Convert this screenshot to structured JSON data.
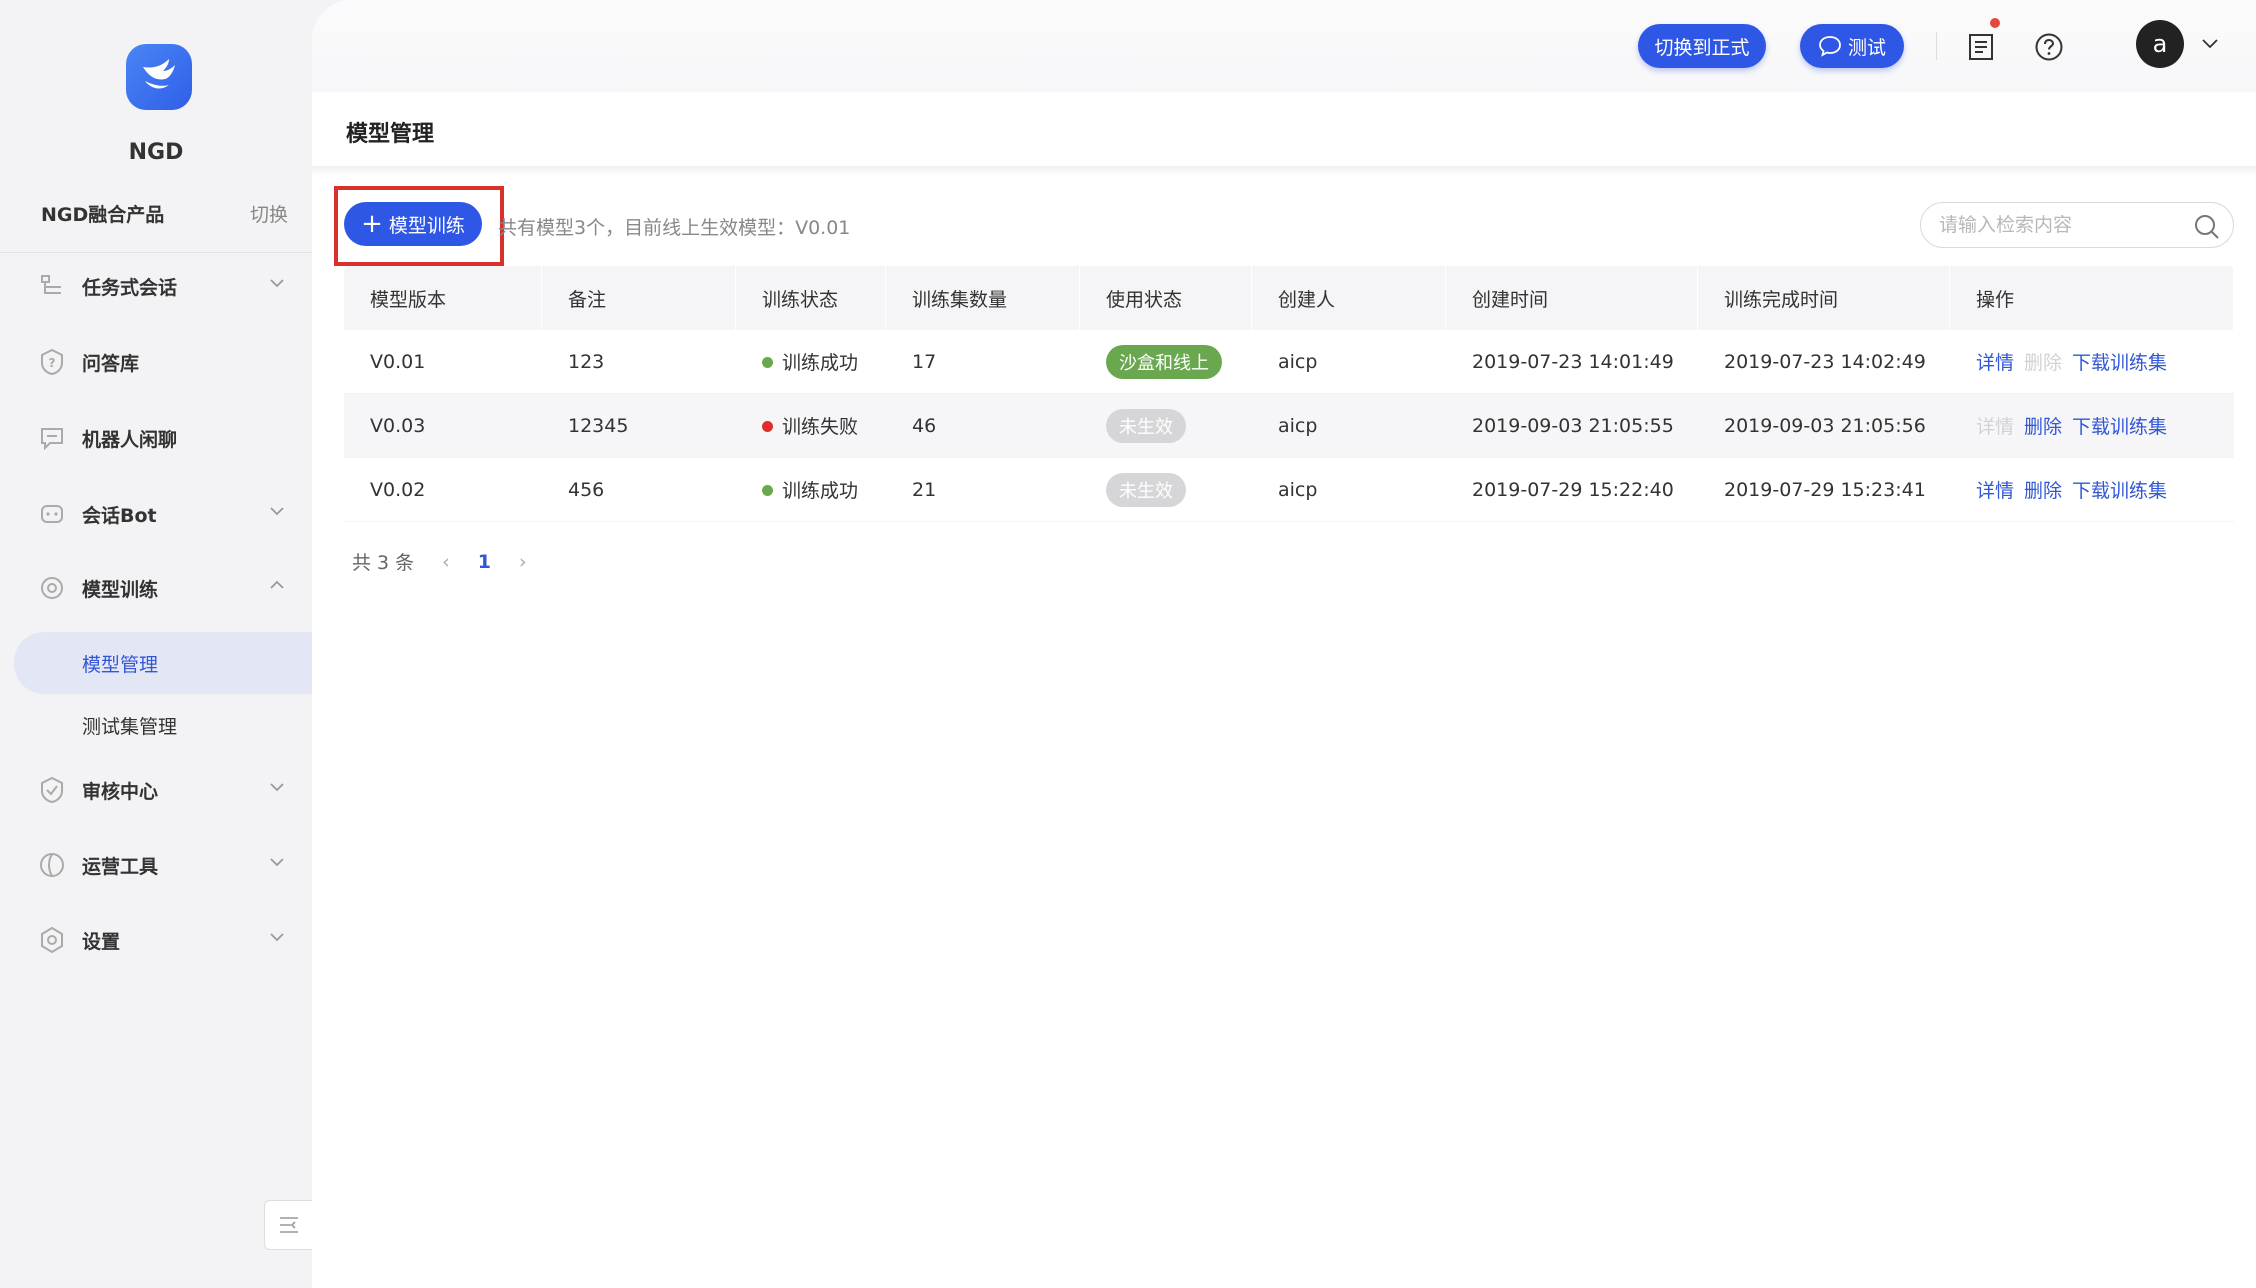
{
  "brand": {
    "name": "NGD",
    "product": "NGD融合产品",
    "switch_label": "切换"
  },
  "sidebar": {
    "items": [
      {
        "label": "任务式会话",
        "icon": "flow-icon",
        "has_chevron": true,
        "expanded": false
      },
      {
        "label": "问答库",
        "icon": "question-shield-icon",
        "has_chevron": false
      },
      {
        "label": "机器人闲聊",
        "icon": "chat-bubble-icon",
        "has_chevron": false
      },
      {
        "label": "会话Bot",
        "icon": "robot-icon",
        "has_chevron": true,
        "expanded": false
      },
      {
        "label": "模型训练",
        "icon": "model-icon",
        "has_chevron": true,
        "expanded": true
      },
      {
        "label": "审核中心",
        "icon": "check-shield-icon",
        "has_chevron": true,
        "expanded": false
      },
      {
        "label": "运营工具",
        "icon": "ops-icon",
        "has_chevron": true,
        "expanded": false
      },
      {
        "label": "设置",
        "icon": "settings-icon",
        "has_chevron": true,
        "expanded": false
      }
    ],
    "sub_items": [
      {
        "label": "模型管理",
        "active": true
      },
      {
        "label": "测试集管理",
        "active": false
      }
    ]
  },
  "topbar": {
    "switch_button": "切换到正式",
    "test_button": "测试",
    "avatar_letter": "a"
  },
  "page": {
    "title": "模型管理",
    "train_button": "模型训练",
    "summary": "共有模型3个，目前线上生效模型：V0.01",
    "search_placeholder": "请输入检索内容"
  },
  "table": {
    "headers": [
      "模型版本",
      "备注",
      "训练状态",
      "训练集数量",
      "使用状态",
      "创建人",
      "创建时间",
      "训练完成时间",
      "操作"
    ],
    "rows": [
      {
        "version": "V0.01",
        "note": "123",
        "train_status": "训练成功",
        "status_color": "#6aa84f",
        "count": "17",
        "use_status": "沙盒和线上",
        "use_active": true,
        "creator": "aicp",
        "created": "2019-07-23 14:01:49",
        "finished": "2019-07-23 14:02:49",
        "actions": [
          {
            "label": "详情",
            "enabled": true
          },
          {
            "label": "删除",
            "enabled": false
          },
          {
            "label": "下载训练集",
            "enabled": true
          }
        ]
      },
      {
        "version": "V0.03",
        "note": "12345",
        "train_status": "训练失败",
        "status_color": "#d9302b",
        "count": "46",
        "use_status": "未生效",
        "use_active": false,
        "creator": "aicp",
        "created": "2019-09-03 21:05:55",
        "finished": "2019-09-03 21:05:56",
        "actions": [
          {
            "label": "详情",
            "enabled": false
          },
          {
            "label": "删除",
            "enabled": true
          },
          {
            "label": "下载训练集",
            "enabled": true
          }
        ]
      },
      {
        "version": "V0.02",
        "note": "456",
        "train_status": "训练成功",
        "status_color": "#6aa84f",
        "count": "21",
        "use_status": "未生效",
        "use_active": false,
        "creator": "aicp",
        "created": "2019-07-29 15:22:40",
        "finished": "2019-07-29 15:23:41",
        "actions": [
          {
            "label": "详情",
            "enabled": true
          },
          {
            "label": "删除",
            "enabled": true
          },
          {
            "label": "下载训练集",
            "enabled": true
          }
        ]
      }
    ]
  },
  "pagination": {
    "total_label": "共 3 条",
    "current_page": "1"
  }
}
